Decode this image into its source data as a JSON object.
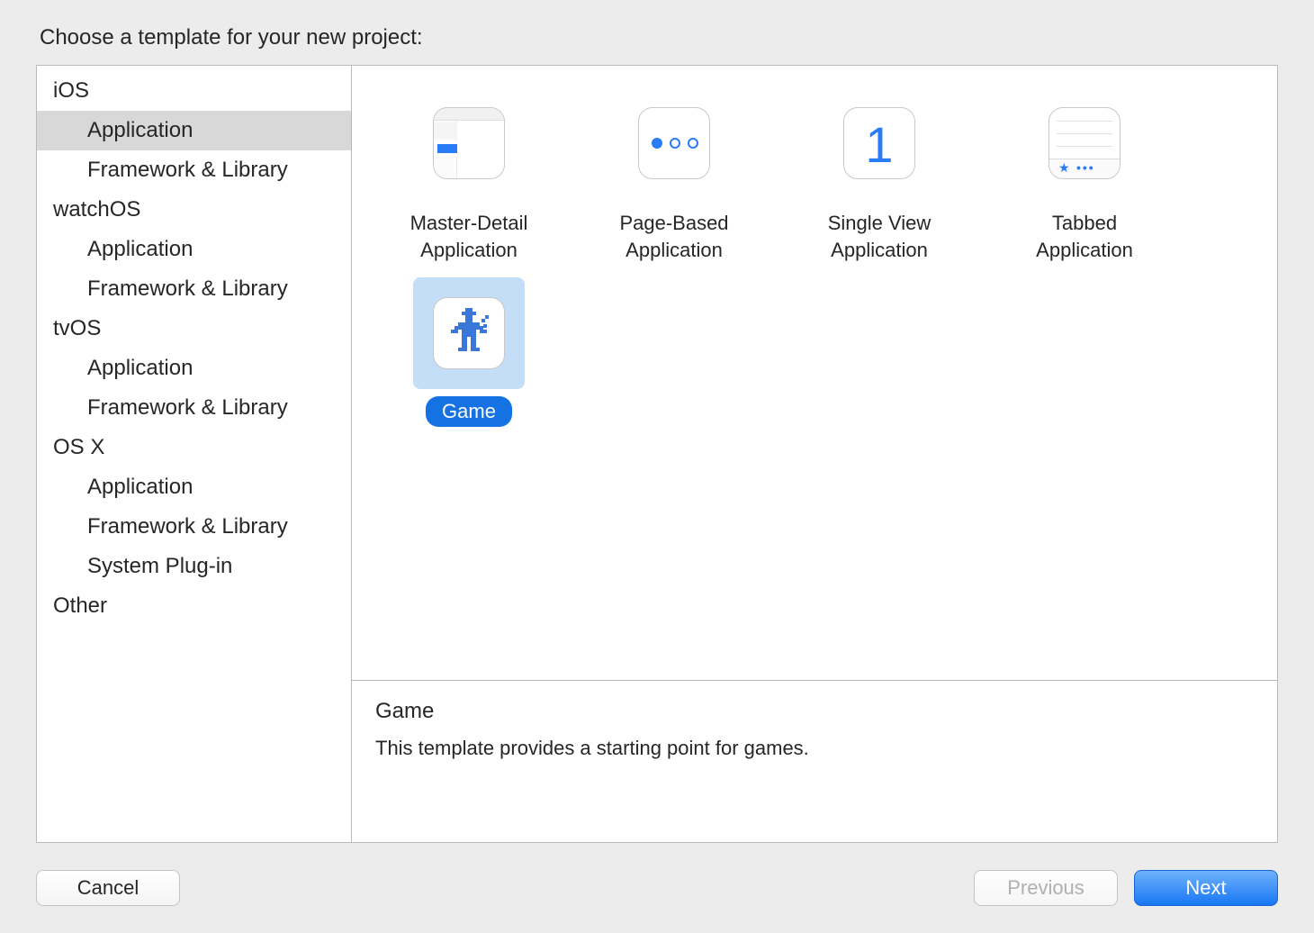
{
  "dialog": {
    "title": "Choose a template for your new project:"
  },
  "sidebar": {
    "sections": [
      {
        "header": "iOS",
        "items": [
          "Application",
          "Framework & Library"
        ],
        "selected_index": 0
      },
      {
        "header": "watchOS",
        "items": [
          "Application",
          "Framework & Library"
        ]
      },
      {
        "header": "tvOS",
        "items": [
          "Application",
          "Framework & Library"
        ]
      },
      {
        "header": "OS X",
        "items": [
          "Application",
          "Framework & Library",
          "System Plug-in"
        ]
      },
      {
        "header": "Other",
        "items": []
      }
    ]
  },
  "templates": [
    {
      "id": "master-detail",
      "label": "Master-Detail Application"
    },
    {
      "id": "page-based",
      "label": "Page-Based Application"
    },
    {
      "id": "single-view",
      "label": "Single View Application"
    },
    {
      "id": "tabbed",
      "label": "Tabbed Application"
    },
    {
      "id": "game",
      "label": "Game",
      "selected": true
    }
  ],
  "description": {
    "title": "Game",
    "body": "This template provides a starting point for games."
  },
  "buttons": {
    "cancel": "Cancel",
    "previous": "Previous",
    "next": "Next"
  }
}
